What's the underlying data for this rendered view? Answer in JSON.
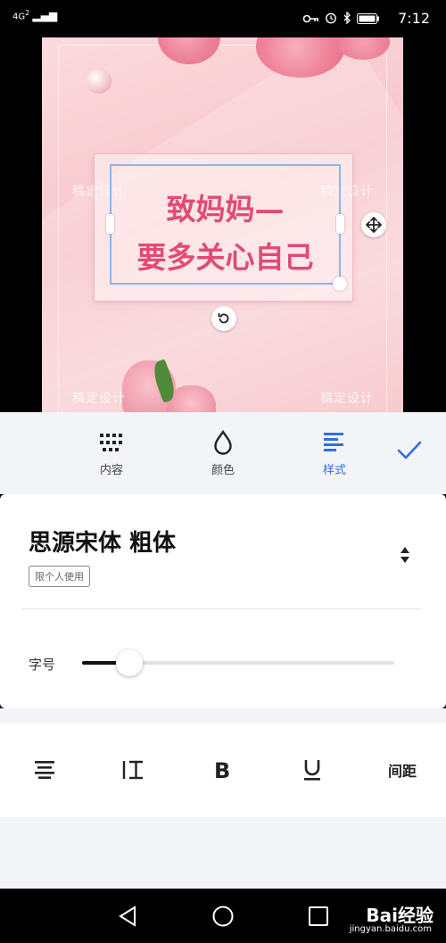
{
  "status": {
    "network": "4G",
    "signal_sup": "2",
    "time": "7:12"
  },
  "canvas": {
    "title_line1": "致妈妈—",
    "title_line2": "要多关心自己",
    "watermark_left": "稿定设计",
    "watermark_right": "稿定设计",
    "watermark_bottom_left": "稿定设计",
    "watermark_bottom_right": "稿定设计",
    "accent": "#e24a74"
  },
  "toolbar": {
    "items": [
      {
        "label": "内容",
        "icon": "grid-dots-icon"
      },
      {
        "label": "颜色",
        "icon": "droplet-icon"
      },
      {
        "label": "样式",
        "icon": "text-align-left-icon",
        "active": true
      }
    ],
    "confirm_icon": "check-icon",
    "active_color": "#2f6fe0"
  },
  "font_panel": {
    "font_name": "思源宋体 粗体",
    "license": "限个人使用",
    "size_label": "字号",
    "size_value": 0.15
  },
  "style_row": {
    "spacing_label": "间距"
  },
  "navbar": {
    "brand": "Bai经验",
    "brand_sub": "jingyan.baidu.com"
  }
}
